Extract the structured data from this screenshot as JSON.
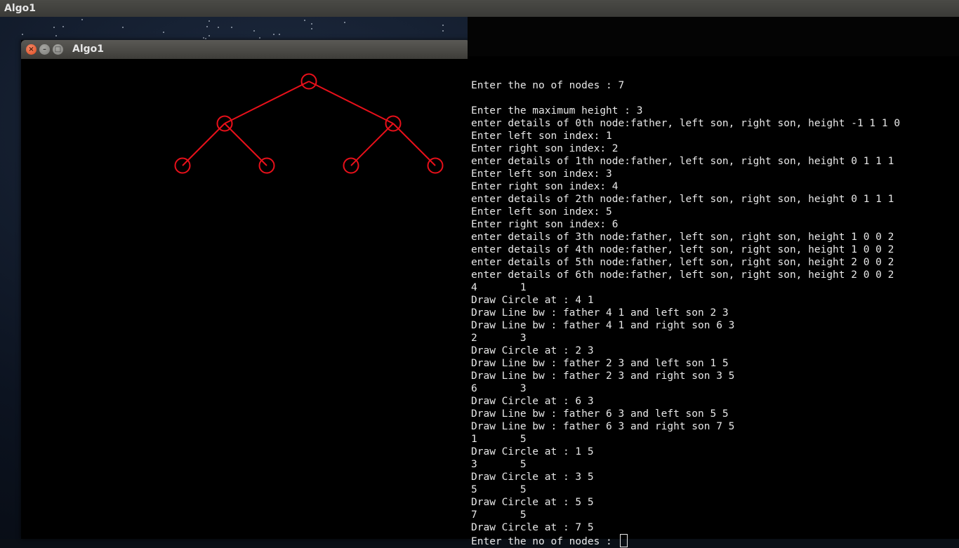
{
  "top_panel": {
    "title": "Algo1"
  },
  "algo_window": {
    "title": "Algo1",
    "buttons": {
      "close": "×",
      "minimize": "–",
      "maximize": "□"
    },
    "tree": {
      "stroke_color": "#e8101a",
      "nodes": [
        {
          "id": 0,
          "x": 4,
          "level": 1
        },
        {
          "id": 1,
          "x": 2,
          "level": 3
        },
        {
          "id": 2,
          "x": 6,
          "level": 3
        },
        {
          "id": 3,
          "x": 1,
          "level": 5
        },
        {
          "id": 4,
          "x": 3,
          "level": 5
        },
        {
          "id": 5,
          "x": 5,
          "level": 5
        },
        {
          "id": 6,
          "x": 7,
          "level": 5
        }
      ],
      "edges": [
        [
          0,
          1
        ],
        [
          0,
          2
        ],
        [
          1,
          3
        ],
        [
          1,
          4
        ],
        [
          2,
          5
        ],
        [
          2,
          6
        ]
      ]
    }
  },
  "terminal": {
    "lines": [
      "Enter the no of nodes : 7",
      "",
      "Enter the maximum height : 3",
      "enter details of 0th node:father, left son, right son, height -1 1 1 0",
      "Enter left son index: 1",
      "Enter right son index: 2",
      "enter details of 1th node:father, left son, right son, height 0 1 1 1",
      "Enter left son index: 3",
      "Enter right son index: 4",
      "enter details of 2th node:father, left son, right son, height 0 1 1 1",
      "Enter left son index: 5",
      "Enter right son index: 6",
      "enter details of 3th node:father, left son, right son, height 1 0 0 2",
      "enter details of 4th node:father, left son, right son, height 1 0 0 2",
      "enter details of 5th node:father, left son, right son, height 2 0 0 2",
      "enter details of 6th node:father, left son, right son, height 2 0 0 2",
      "4       1",
      "Draw Circle at : 4 1",
      "Draw Line bw : father 4 1 and left son 2 3",
      "Draw Line bw : father 4 1 and right son 6 3",
      "2       3",
      "Draw Circle at : 2 3",
      "Draw Line bw : father 2 3 and left son 1 5",
      "Draw Line bw : father 2 3 and right son 3 5",
      "6       3",
      "Draw Circle at : 6 3",
      "Draw Line bw : father 6 3 and left son 5 5",
      "Draw Line bw : father 6 3 and right son 7 5",
      "1       5",
      "Draw Circle at : 1 5",
      "3       5",
      "Draw Circle at : 3 5",
      "5       5",
      "Draw Circle at : 5 5",
      "7       5",
      "Draw Circle at : 7 5"
    ],
    "prompt": "Enter the no of nodes : "
  }
}
